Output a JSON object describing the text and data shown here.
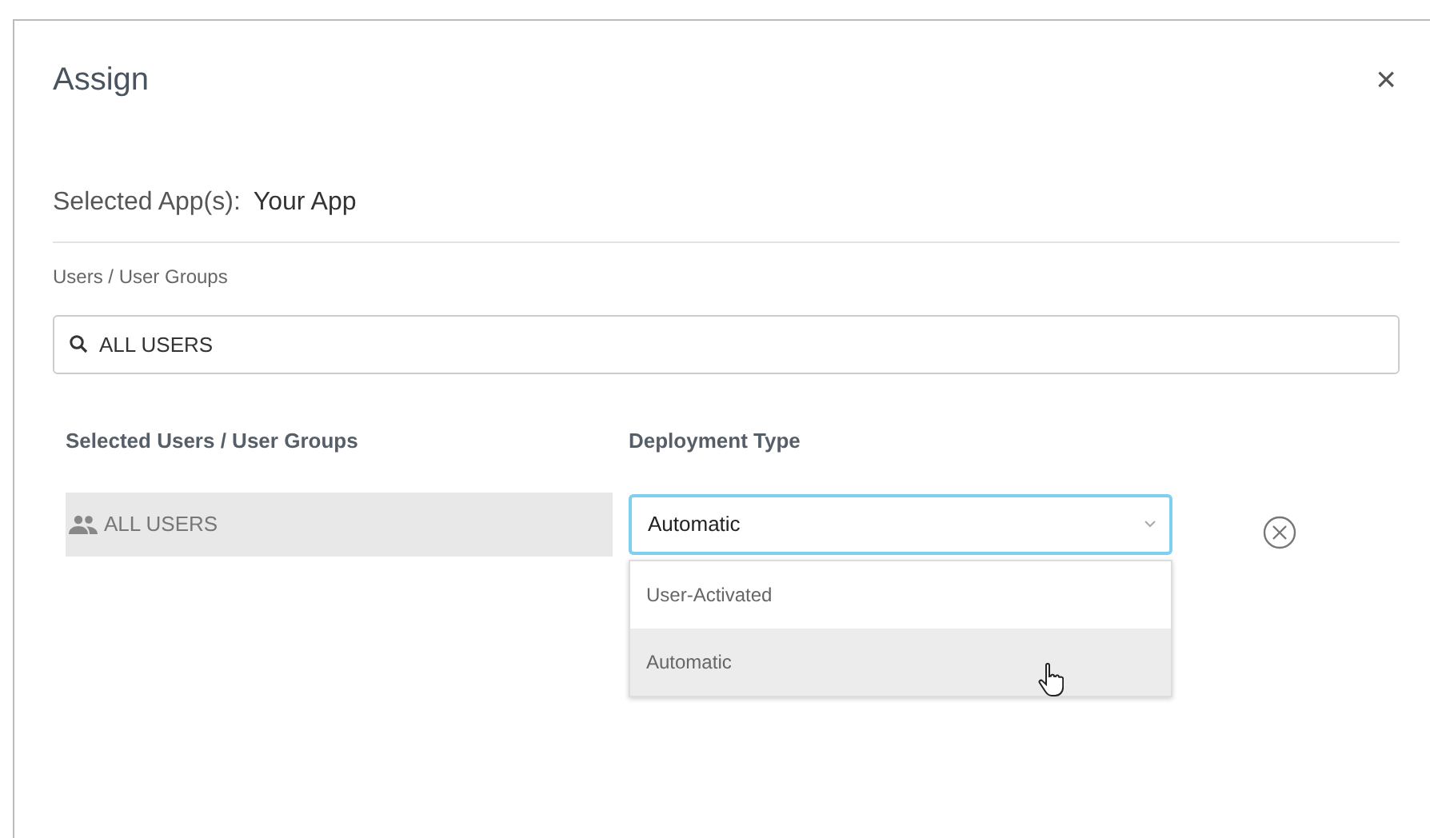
{
  "dialog": {
    "title": "Assign",
    "close": "×"
  },
  "selected_app": {
    "label": "Selected App(s):",
    "value": "Your App"
  },
  "users_label": "Users / User Groups",
  "search": {
    "value": "ALL USERS"
  },
  "columns": [
    "Selected Users / User Groups",
    "Deployment Type"
  ],
  "rows": [
    {
      "user": "ALL USERS",
      "deployment": "Automatic",
      "expanded": true,
      "options": [
        {
          "label": "User-Activated",
          "highlighted": false
        },
        {
          "label": "Automatic",
          "highlighted": true
        }
      ]
    }
  ]
}
